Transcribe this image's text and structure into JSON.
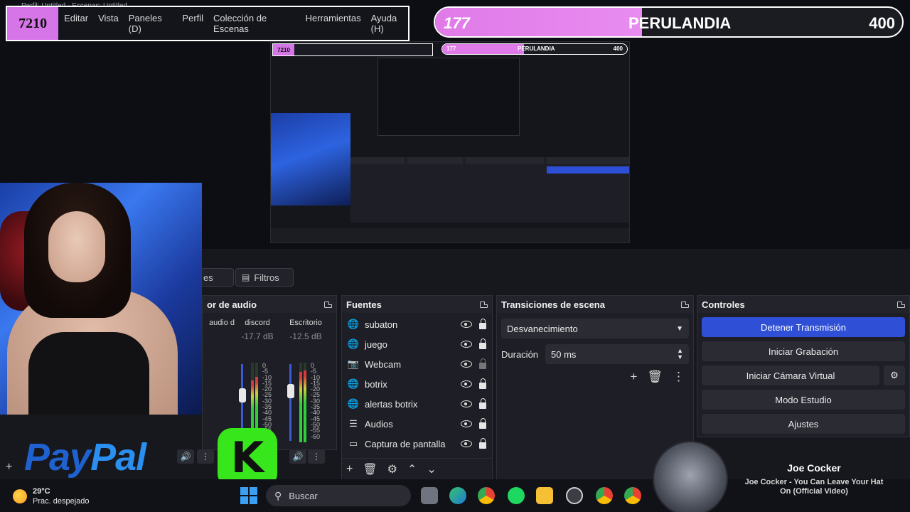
{
  "window": {
    "title": "Perfil: Untitled - Escenas: Untitled"
  },
  "overlay": {
    "counter": "7210",
    "goal_current": "177",
    "goal_name": "PERULANDIA",
    "goal_target": "400",
    "goal_progress_fraction": 0.4425,
    "paypal_left": "Pay",
    "paypal_right": "Pal",
    "kick_letter": "K"
  },
  "menu": {
    "items": [
      "Editar",
      "Vista",
      "Paneles (D)",
      "Perfil",
      "Colección de Escenas",
      "Herramientas",
      "Ayuda (H)"
    ]
  },
  "tabs": {
    "partial": "es",
    "filters": "Filtros"
  },
  "mixer": {
    "title": "or de audio",
    "channels": [
      {
        "name": "audio d",
        "db": ""
      },
      {
        "name": "discord",
        "db": "-17.7 dB"
      },
      {
        "name": "Escritorio",
        "db": "-12.5 dB"
      }
    ],
    "scale": [
      "0",
      "-5",
      "-10",
      "-15",
      "-20",
      "-25",
      "-30",
      "-35",
      "-40",
      "-45",
      "-50",
      "-55",
      "-60"
    ]
  },
  "sources": {
    "title": "Fuentes",
    "items": [
      {
        "label": "subaton",
        "icon": "browser-icon",
        "locked_dim": false
      },
      {
        "label": "juego",
        "icon": "browser-icon",
        "locked_dim": false
      },
      {
        "label": "Webcam",
        "icon": "camera-icon",
        "locked_dim": true
      },
      {
        "label": "botrix",
        "icon": "browser-icon",
        "locked_dim": false
      },
      {
        "label": "alertas botrix",
        "icon": "browser-icon",
        "locked_dim": false
      },
      {
        "label": "Audios",
        "icon": "list-icon",
        "locked_dim": false
      },
      {
        "label": "Captura de pantalla",
        "icon": "monitor-icon",
        "locked_dim": false
      }
    ]
  },
  "transitions": {
    "title": "Transiciones de escena",
    "selected": "Desvanecimiento",
    "duration_label": "Duración",
    "duration_value": "50 ms"
  },
  "controls": {
    "title": "Controles",
    "stop_stream": "Detener Transmisión",
    "start_recording": "Iniciar Grabación",
    "start_virtual_cam": "Iniciar Cámara Virtual",
    "studio_mode": "Modo Estudio",
    "settings": "Ajustes"
  },
  "taskbar": {
    "temperature": "29°C",
    "weather": "Prac. despejado",
    "search_placeholder": "Buscar"
  },
  "now_playing": {
    "artist": "Joe Cocker",
    "track": "Joe Cocker - You Can Leave Your Hat On (Official Video)"
  },
  "preview_mini": {
    "counter": "7210",
    "goal_current": "177",
    "goal_name": "PERULANDIA",
    "goal_target": "400"
  },
  "colors": {
    "accent_pink": "#e07ae8",
    "primary_blue": "#2f4fd6",
    "kick_green": "#37e61b",
    "paypal_blue": "#1f62cf"
  }
}
